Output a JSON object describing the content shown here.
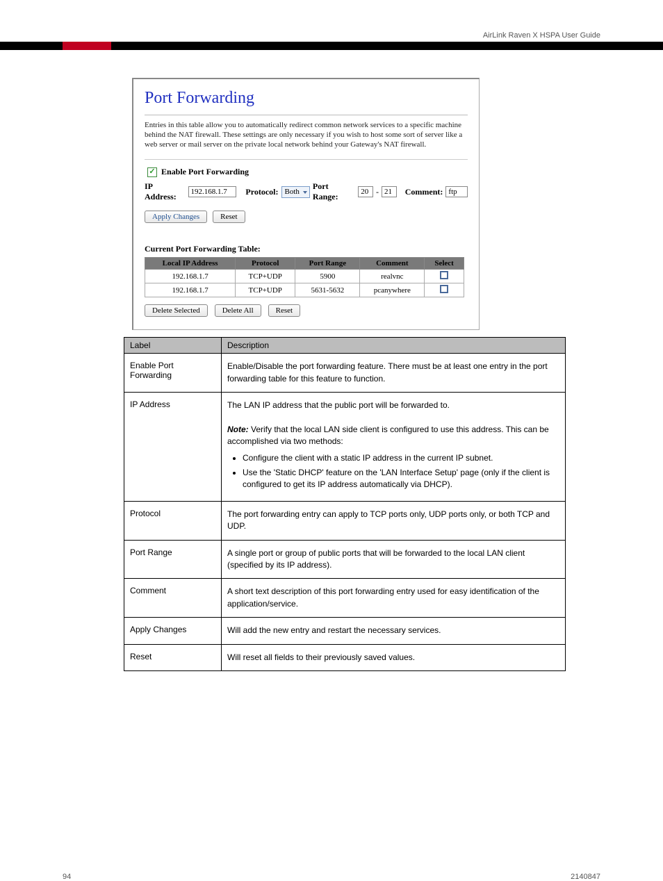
{
  "header": {
    "right": "AirLink Raven X HSPA User Guide"
  },
  "screenshot": {
    "title": "Port Forwarding",
    "description": "Entries in this table allow you to automatically redirect common network services to a specific machine behind the NAT firewall. These settings are only necessary if you wish to host some sort of server like a web server or mail server on the private local network behind your Gateway's NAT firewall.",
    "enable_label": "Enable Port Forwarding",
    "enable_checked": true,
    "ip_label": "IP Address:",
    "ip_value": "192.168.1.7",
    "protocol_label": "Protocol:",
    "protocol_value": "Both",
    "portrange_label": "Port Range:",
    "port_from": "20",
    "port_dash": "-",
    "port_to": "21",
    "comment_label": "Comment:",
    "comment_value": "ftp",
    "apply_btn": "Apply Changes",
    "reset_btn": "Reset",
    "table_caption": "Current Port Forwarding Table:",
    "headers": [
      "Local IP Address",
      "Protocol",
      "Port Range",
      "Comment",
      "Select"
    ],
    "rows": [
      {
        "ip": "192.168.1.7",
        "protocol": "TCP+UDP",
        "range": "5900",
        "comment": "realvnc"
      },
      {
        "ip": "192.168.1.7",
        "protocol": "TCP+UDP",
        "range": "5631-5632",
        "comment": "pcanywhere"
      }
    ],
    "delete_selected": "Delete Selected",
    "delete_all": "Delete All",
    "reset2": "Reset"
  },
  "def_table": {
    "hdr_label": "Label",
    "hdr_desc": "Description",
    "rows": [
      {
        "label": "Enable Port Forwarding",
        "desc": "Enable/Disable the port forwarding feature. There must be at least one entry in the port forwarding table for this feature to function."
      },
      {
        "label": "IP Address",
        "desc_intro": "The LAN IP address that the public port will be forwarded to.",
        "note_head": "Note:",
        "note_body": " Verify that the local LAN side client is configured to use this address. This can be accomplished via two methods:",
        "bullets": [
          "Configure the client with a static IP address in the current IP subnet.",
          "Use the 'Static DHCP' feature on the 'LAN Interface Setup' page (only if the client is configured to get its IP address automatically via DHCP)."
        ]
      },
      {
        "label": "Protocol",
        "desc": "The port forwarding entry can apply to TCP ports only, UDP ports only, or both TCP and UDP."
      },
      {
        "label": "Port Range",
        "desc": "A single port or group of public ports that will be forwarded to the local LAN client (specified by its IP address)."
      },
      {
        "label": "Comment",
        "desc": "A short text description of this port forwarding entry used for easy identification of the application/service."
      },
      {
        "label": "Apply Changes",
        "desc": "Will add the new entry and restart the necessary services."
      },
      {
        "label": "Reset",
        "desc": "Will reset all fields to their previously saved values."
      }
    ]
  },
  "footer": {
    "left": "94",
    "right": "2140847"
  }
}
